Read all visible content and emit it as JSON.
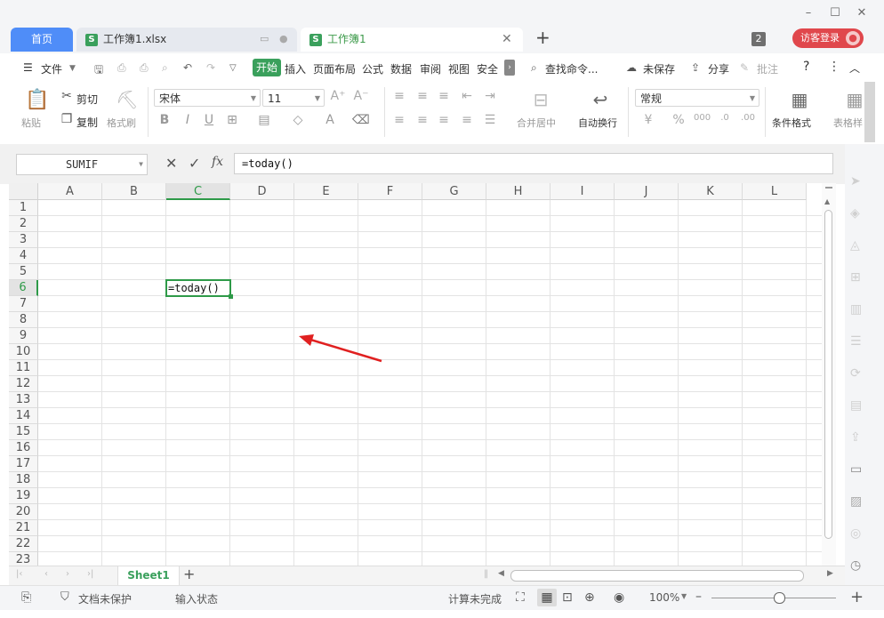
{
  "window": {
    "minimize": "–",
    "maximize": "☐",
    "close": "✕"
  },
  "tabs": {
    "home": "首页",
    "file": "工作簿1.xlsx",
    "active": "工作簿1",
    "add": "+",
    "badge_count": "2",
    "login": "访客登录"
  },
  "menu": {
    "file": "文件",
    "items": [
      "开始",
      "插入",
      "页面布局",
      "公式",
      "数据",
      "审阅",
      "视图",
      "安全"
    ],
    "search": "查找命令...",
    "unsaved": "未保存",
    "share": "分享",
    "comment": "批注",
    "help": "?"
  },
  "ribbon": {
    "paste": "粘贴",
    "cut": "剪切",
    "copy": "复制",
    "format_painter": "格式刷",
    "font_name": "宋体",
    "font_size": "11",
    "merge_center": "合并居中",
    "wrap_text": "自动换行",
    "number_format": "常规",
    "conditional_format": "条件格式",
    "table_style": "表格样"
  },
  "formula_bar": {
    "name_box": "SUMIF",
    "fx": "fx",
    "formula": "=today()"
  },
  "grid": {
    "columns": [
      "A",
      "B",
      "C",
      "D",
      "E",
      "F",
      "G",
      "H",
      "I",
      "J",
      "K",
      "L"
    ],
    "rows": [
      "1",
      "2",
      "3",
      "4",
      "5",
      "6",
      "7",
      "8",
      "9",
      "10",
      "11",
      "12",
      "13",
      "14",
      "15",
      "16",
      "17",
      "18",
      "19",
      "20",
      "21",
      "22",
      "23"
    ],
    "active_cell_ref": "C6",
    "active_cell_value": "=today()"
  },
  "sheets": {
    "name": "Sheet1",
    "add": "+"
  },
  "status": {
    "doc_unprotected": "文档未保护",
    "input_state": "输入状态",
    "calc_incomplete": "计算未完成",
    "zoom": "100%"
  },
  "colors": {
    "accent_green": "#3aa05c",
    "home_tab_blue": "#4f8df8",
    "login_red": "#e0474c",
    "annotation_arrow": "#e02020"
  }
}
